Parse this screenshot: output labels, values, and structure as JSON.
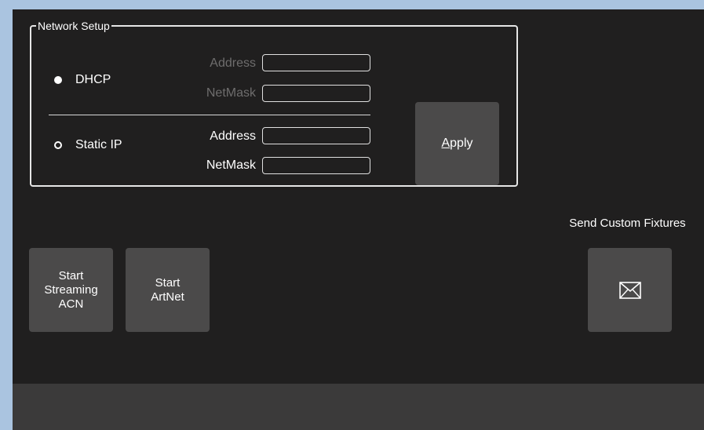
{
  "network_setup": {
    "title": "Network Setup",
    "dhcp": {
      "label": "DHCP",
      "selected": true,
      "address_label": "Address",
      "address_value": "",
      "netmask_label": "NetMask",
      "netmask_value": ""
    },
    "static_ip": {
      "label": "Static IP",
      "selected": false,
      "address_label": "Address",
      "address_value": "",
      "netmask_label": "NetMask",
      "netmask_value": ""
    },
    "apply": {
      "underlined_char": "A",
      "label_rest": "pply"
    }
  },
  "actions": {
    "start_acn": [
      "Start",
      "Streaming",
      "ACN"
    ],
    "start_artnet": [
      "Start",
      "ArtNet"
    ]
  },
  "send_custom_fixtures": {
    "title": "Send Custom Fixtures",
    "icon": "envelope-icon"
  }
}
